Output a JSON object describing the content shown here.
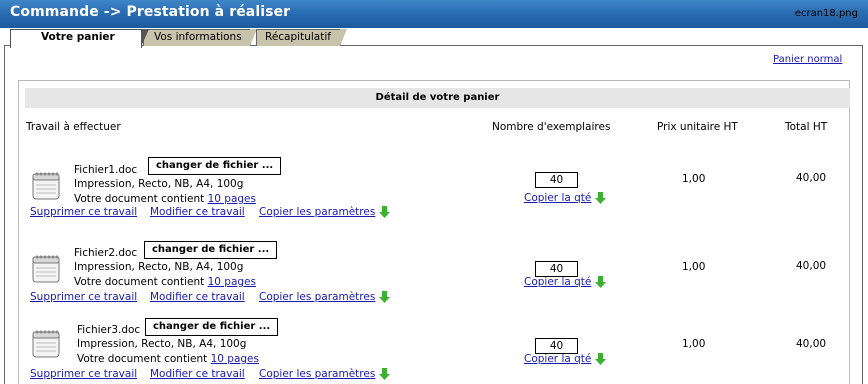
{
  "window": {
    "title": "Commande -> Prestation à réaliser",
    "filename": "ecran18.png"
  },
  "tabs": [
    {
      "label": "Votre panier",
      "active": true
    },
    {
      "label": "Vos informations",
      "active": false
    },
    {
      "label": "Récapitulatif",
      "active": false
    }
  ],
  "panier_normal": "Panier normal",
  "detail": {
    "heading": "Détail de votre panier",
    "columns": {
      "work": "Travail à effectuer",
      "copies": "Nombre d'exemplaires",
      "unit_price": "Prix unitaire HT",
      "total": "Total HT"
    }
  },
  "items": [
    {
      "filename": "Fichier1.doc",
      "change_button": "changer de fichier ...",
      "description": "Impression, Recto, NB, A4, 100g",
      "contains_prefix": "Votre document contient",
      "pages_link": "10 pages",
      "delete": "Supprimer ce travail",
      "modify": "Modifier ce travail",
      "copy_params": "Copier les paramètres",
      "quantity": "40",
      "copy_qty": "Copier la qté",
      "unit_price": "1,00",
      "total": "40,00"
    },
    {
      "filename": "Fichier2.doc",
      "change_button": "changer de fichier ...",
      "description": "Impression, Recto, NB, A4, 100g",
      "contains_prefix": "Votre document contient",
      "pages_link": "10 pages",
      "delete": "Supprimer ce travail",
      "modify": "Modifier ce travail",
      "copy_params": "Copier les paramètres",
      "quantity": "40",
      "copy_qty": "Copier la qté",
      "unit_price": "1,00",
      "total": "40,00"
    },
    {
      "filename": "Fichier3.doc",
      "change_button": "changer de fichier ...",
      "description": "Impression, Recto, NB, A4, 100g",
      "contains_prefix": "Votre document contient",
      "pages_link": "10 pages",
      "delete": "Supprimer ce travail",
      "modify": "Modifier ce travail",
      "copy_params": "Copier les paramètres",
      "quantity": "40",
      "copy_qty": "Copier la qté",
      "unit_price": "1,00",
      "total": "40,00"
    }
  ],
  "colors": {
    "titlebar": "#2a6db2",
    "link": "#1a1ab0",
    "arrow": "#3cb030",
    "inactive_tab": "#c8c4ac"
  }
}
